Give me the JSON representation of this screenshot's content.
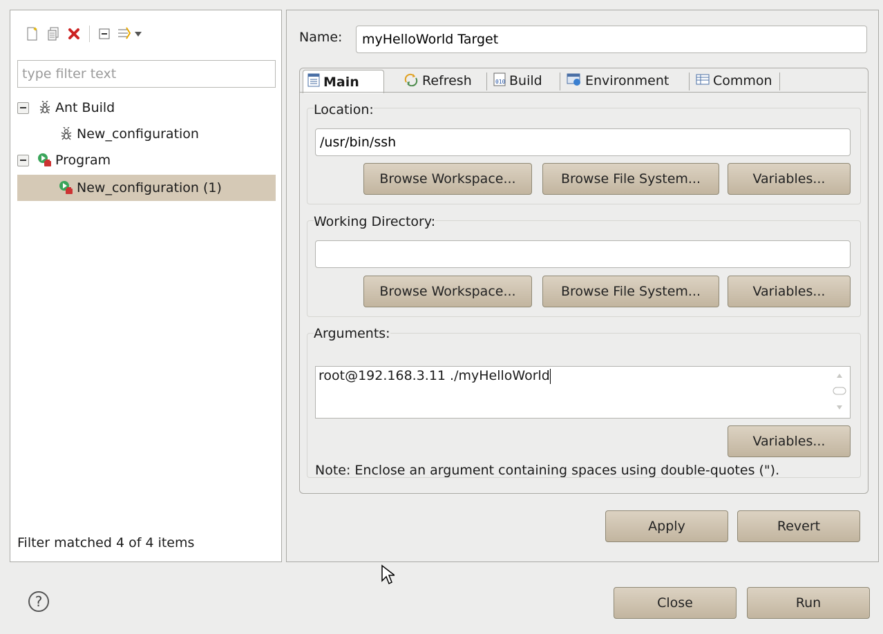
{
  "toolbar": {
    "icons": [
      "new-configuration-icon",
      "duplicate-icon",
      "delete-icon",
      "collapse-all-icon",
      "filter-icon",
      "dropdown-arrow-icon"
    ]
  },
  "filter": {
    "placeholder": "type filter text",
    "value": ""
  },
  "tree": [
    {
      "label": "Ant Build",
      "icon": "ant-icon",
      "expanded": true,
      "level": 0
    },
    {
      "label": "New_configuration",
      "icon": "ant-icon",
      "level": 1
    },
    {
      "label": "Program",
      "icon": "program-icon",
      "expanded": true,
      "level": 0
    },
    {
      "label": "New_configuration (1)",
      "icon": "program-icon",
      "level": 1,
      "selected": true
    }
  ],
  "filter_status": "Filter matched 4 of 4 items",
  "name": {
    "label": "Name:",
    "value": "myHelloWorld Target"
  },
  "tabs": [
    {
      "label": "Main",
      "icon": "main-tab-icon",
      "active": true
    },
    {
      "label": "Refresh",
      "icon": "refresh-icon"
    },
    {
      "label": "Build",
      "icon": "build-icon"
    },
    {
      "label": "Environment",
      "icon": "environment-icon"
    },
    {
      "label": "Common",
      "icon": "common-icon"
    }
  ],
  "location": {
    "title": "Location:",
    "value": "/usr/bin/ssh",
    "buttons": [
      "Browse Workspace...",
      "Browse File System...",
      "Variables..."
    ]
  },
  "working_dir": {
    "title": "Working Directory:",
    "value": "",
    "buttons": [
      "Browse Workspace...",
      "Browse File System...",
      "Variables..."
    ]
  },
  "arguments": {
    "title": "Arguments:",
    "value": "root@192.168.3.11 ./myHelloWorld",
    "variables_button": "Variables...",
    "note": "Note: Enclose an argument containing spaces using double-quotes (\")."
  },
  "actions": {
    "apply": "Apply",
    "revert": "Revert"
  },
  "footer": {
    "help_icon": "?",
    "close": "Close",
    "run": "Run"
  },
  "colors": {
    "accent": "#d5c9b6",
    "button": "#cdc2b0",
    "delete": "#cc2222"
  }
}
